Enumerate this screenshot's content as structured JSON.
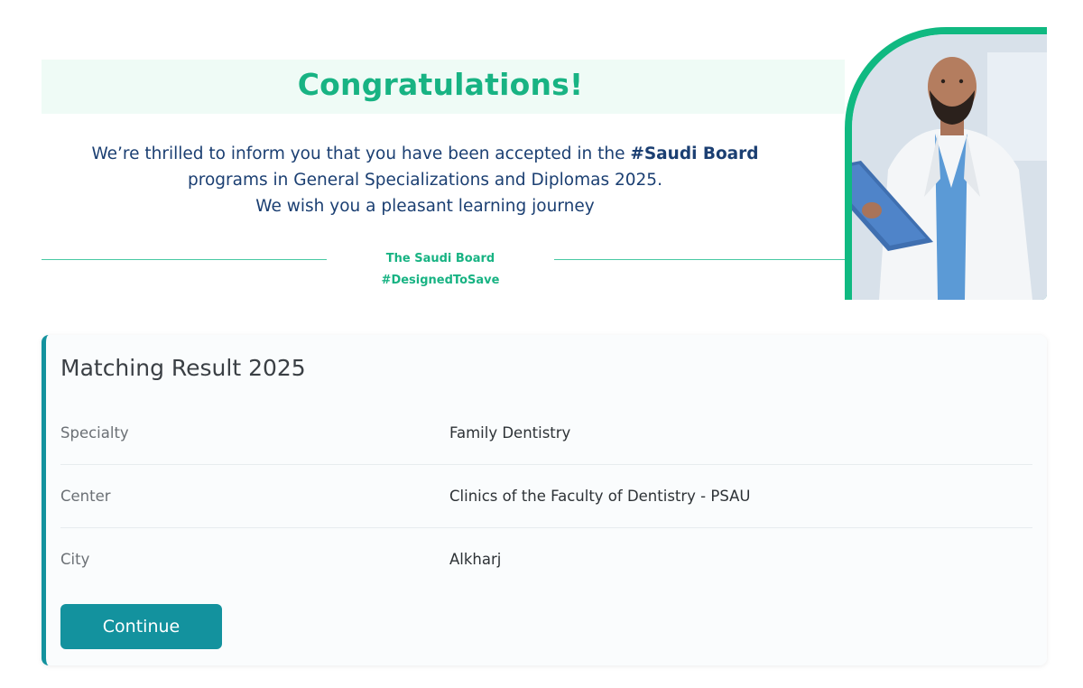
{
  "banner": {
    "title": "Congratulations!"
  },
  "message": {
    "line1_prefix": "We’re thrilled to inform you that you have been accepted in the ",
    "line1_hashtag": "#Saudi Board",
    "line2": "programs in General Specializations and Diplomas 2025.",
    "line3": "We wish you a pleasant learning journey"
  },
  "tagline": "The Saudi Board #DesignedToSave",
  "colors": {
    "accent_green": "#18b383",
    "teal": "#13929e",
    "navy_text": "#1b3f72"
  },
  "result": {
    "title": "Matching Result 2025",
    "rows": [
      {
        "label": "Specialty",
        "value": "Family Dentistry"
      },
      {
        "label": "Center",
        "value": "Clinics of the Faculty of Dentistry - PSAU"
      },
      {
        "label": "City",
        "value": "Alkharj"
      }
    ],
    "continue_label": "Continue"
  }
}
